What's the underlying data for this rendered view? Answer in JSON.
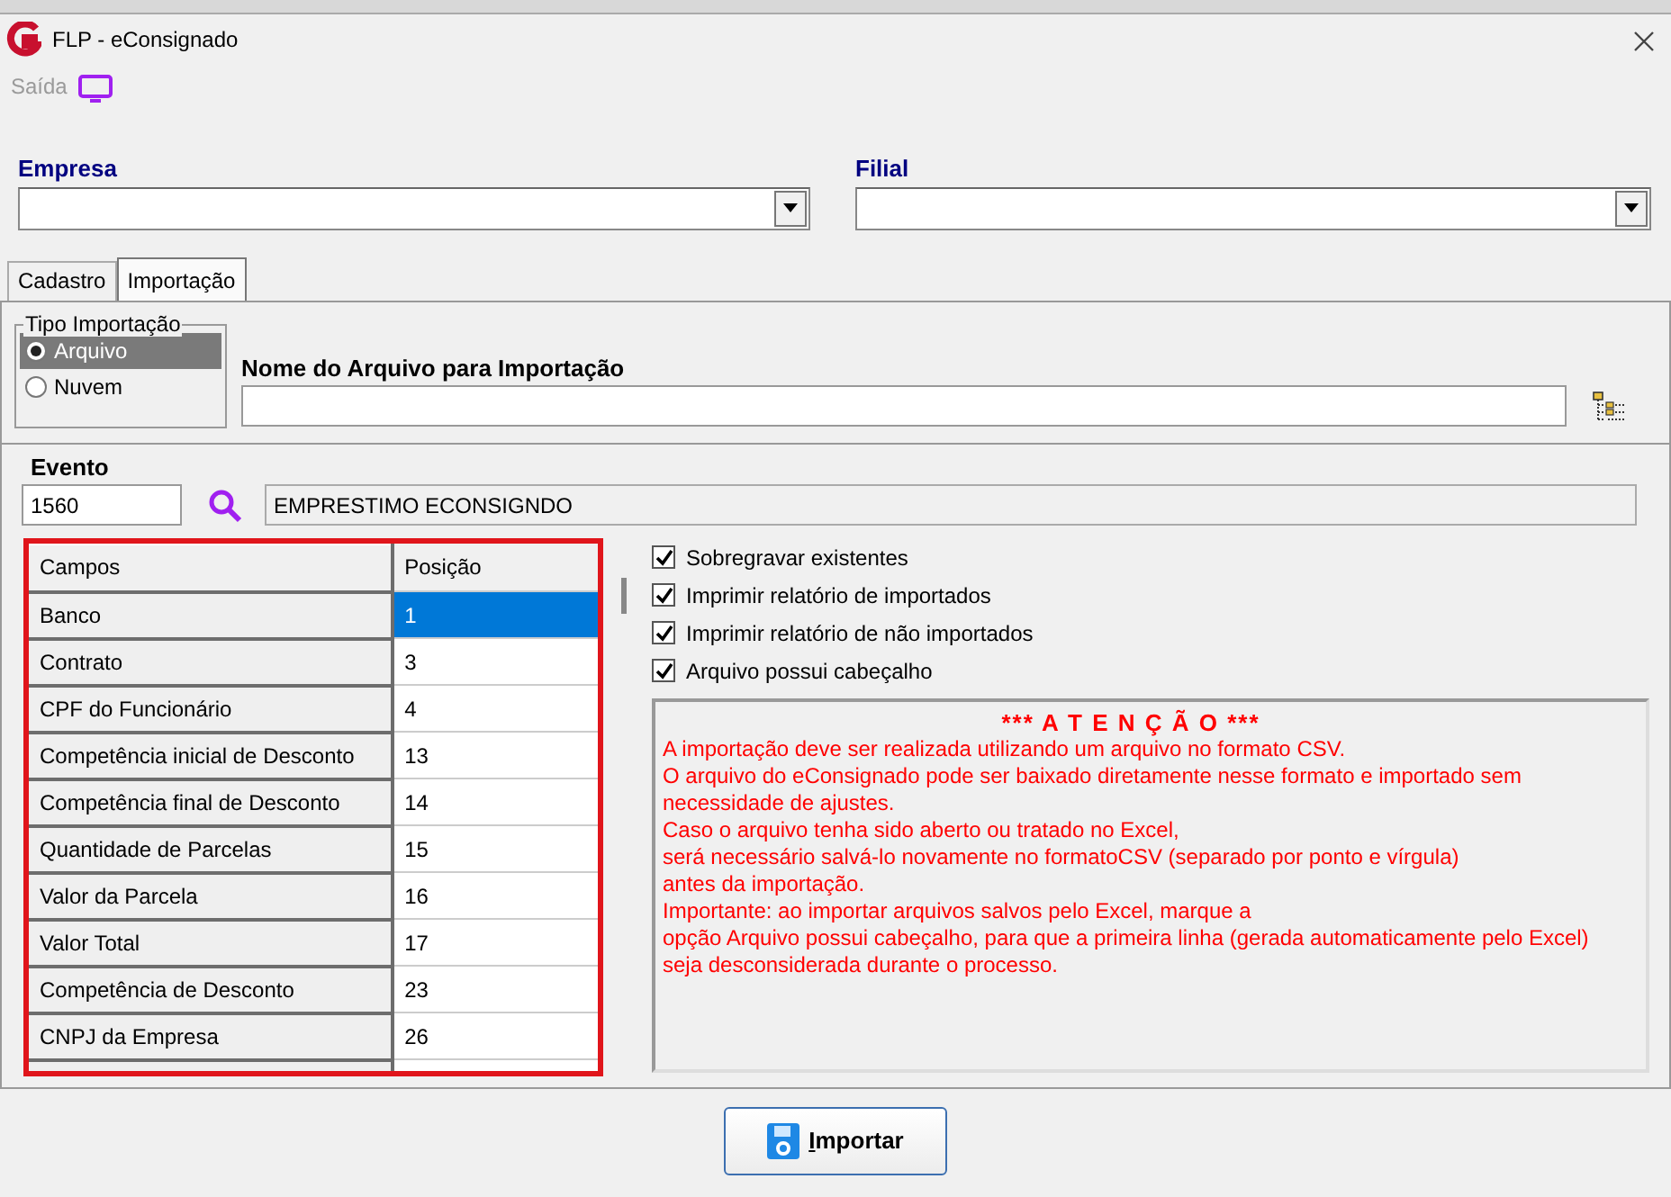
{
  "window": {
    "title": "FLP - eConsignado"
  },
  "menu": [
    {
      "label": "Saída",
      "disabled": true
    }
  ],
  "empresa": {
    "label": "Empresa"
  },
  "filial": {
    "label": "Filial"
  },
  "tabs": [
    {
      "label": "Cadastro",
      "selected": false
    },
    {
      "label": "Importação",
      "selected": true
    }
  ],
  "tipo_importacao": {
    "legend": "Tipo Importação",
    "options": [
      {
        "label": "Arquivo",
        "selected": true
      },
      {
        "label": "Nuvem",
        "selected": false
      }
    ]
  },
  "arquivo": {
    "label": "Nome do Arquivo para Importação"
  },
  "evento": {
    "label": "Evento",
    "code": "1560",
    "description": "EMPRESTIMO ECONSIGNDO"
  },
  "grid": {
    "columns": [
      "Campos",
      "Posição"
    ],
    "rows": [
      {
        "campo": "Banco",
        "posicao": "1",
        "selected": true
      },
      {
        "campo": "Contrato",
        "posicao": "3",
        "selected": false
      },
      {
        "campo": "CPF do Funcionário",
        "posicao": "4",
        "selected": false
      },
      {
        "campo": "Competência inicial de Desconto",
        "posicao": "13",
        "selected": false
      },
      {
        "campo": "Competência final de Desconto",
        "posicao": "14",
        "selected": false
      },
      {
        "campo": "Quantidade de Parcelas",
        "posicao": "15",
        "selected": false
      },
      {
        "campo": "Valor da Parcela",
        "posicao": "16",
        "selected": false
      },
      {
        "campo": "Valor Total",
        "posicao": "17",
        "selected": false
      },
      {
        "campo": "Competência de Desconto",
        "posicao": "23",
        "selected": false
      },
      {
        "campo": "CNPJ da Empresa",
        "posicao": "26",
        "selected": false
      }
    ]
  },
  "options": [
    {
      "label": "Sobregravar existentes",
      "checked": true
    },
    {
      "label": "Imprimir relatório de importados",
      "checked": true
    },
    {
      "label": "Imprimir relatório de não importados",
      "checked": true
    },
    {
      "label": "Arquivo possui cabeçalho",
      "checked": true
    }
  ],
  "attention": {
    "title": "*** A T E N Ç Ã O ***",
    "lines": [
      "A importação deve ser realizada utilizando um arquivo no formato CSV.",
      "O arquivo do eConsignado pode ser baixado diretamente nesse formato e importado sem necessidade de ajustes.",
      "Caso o arquivo tenha sido aberto ou tratado no Excel,",
      "será necessário salvá-lo novamente no formatoCSV (separado por ponto e vírgula)",
      "antes da importação.",
      "Importante: ao importar arquivos salvos pelo Excel, marque a",
      "opção Arquivo possui cabeçalho, para que a primeira linha (gerada automaticamente pelo Excel) seja desconsiderada durante o processo."
    ]
  },
  "buttons": [
    {
      "label": "Importar"
    }
  ]
}
